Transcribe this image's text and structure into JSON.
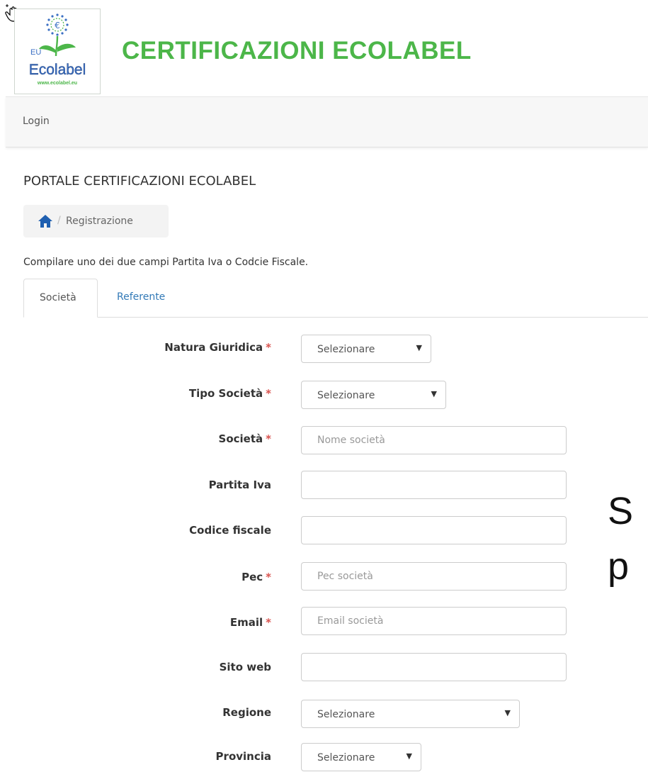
{
  "header": {
    "site_title": "CERTIFICAZIONI ECOLABEL",
    "logo": {
      "eu_text": "EU",
      "brand_text": "Ecolabel",
      "url_text": "www.ecolabel.eu"
    }
  },
  "navbar": {
    "login_label": "Login"
  },
  "page": {
    "portal_title": "PORTALE CERTIFICAZIONI ECOLABEL",
    "breadcrumb": {
      "separator": "/",
      "current": "Registrazione"
    },
    "hint": "Compilare uno dei due campi Partita Iva o Codcie Fiscale."
  },
  "tabs": [
    {
      "label": "Società",
      "active": true
    },
    {
      "label": "Referente",
      "active": false
    }
  ],
  "form": {
    "required_marker": "*",
    "natura_giuridica": {
      "label": "Natura Giuridica",
      "value": "Selezionare"
    },
    "tipo_societa": {
      "label": "Tipo Società",
      "value": "Selezionare"
    },
    "societa": {
      "label": "Società",
      "placeholder": "Nome società"
    },
    "partita_iva": {
      "label": "Partita Iva",
      "placeholder": ""
    },
    "codice_fiscale": {
      "label": "Codice fiscale",
      "placeholder": ""
    },
    "pec": {
      "label": "Pec",
      "placeholder": "Pec società"
    },
    "email": {
      "label": "Email",
      "placeholder": "Email società"
    },
    "sito_web": {
      "label": "Sito web",
      "placeholder": ""
    },
    "regione": {
      "label": "Regione",
      "value": "Selezionare"
    },
    "provincia": {
      "label": "Provincia",
      "value": "Selezionare"
    }
  },
  "overlay": {
    "line1": "S",
    "line2": "p"
  },
  "colors": {
    "brand_green": "#4cb649",
    "link_blue": "#337ab7",
    "required_red": "#d9534f"
  }
}
